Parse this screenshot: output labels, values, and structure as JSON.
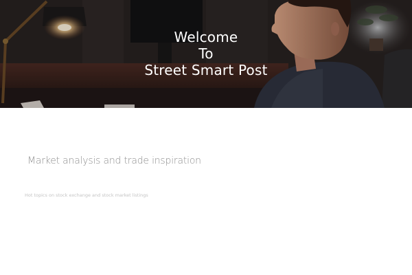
{
  "hero": {
    "title_lines": [
      "Welcome",
      "To",
      "Street Smart Post"
    ]
  },
  "main": {
    "tagline": "Market analysis and trade inspiration",
    "subtext": "Hot topics on stock exchange and stock  market listings"
  },
  "colors": {
    "hero_dark": "#1d1a1a",
    "lamp_glow": "#f7d7a0",
    "tagline_text": "#8f8f8f",
    "subtext_text": "#c4c4c4",
    "background": "#ffffff"
  }
}
